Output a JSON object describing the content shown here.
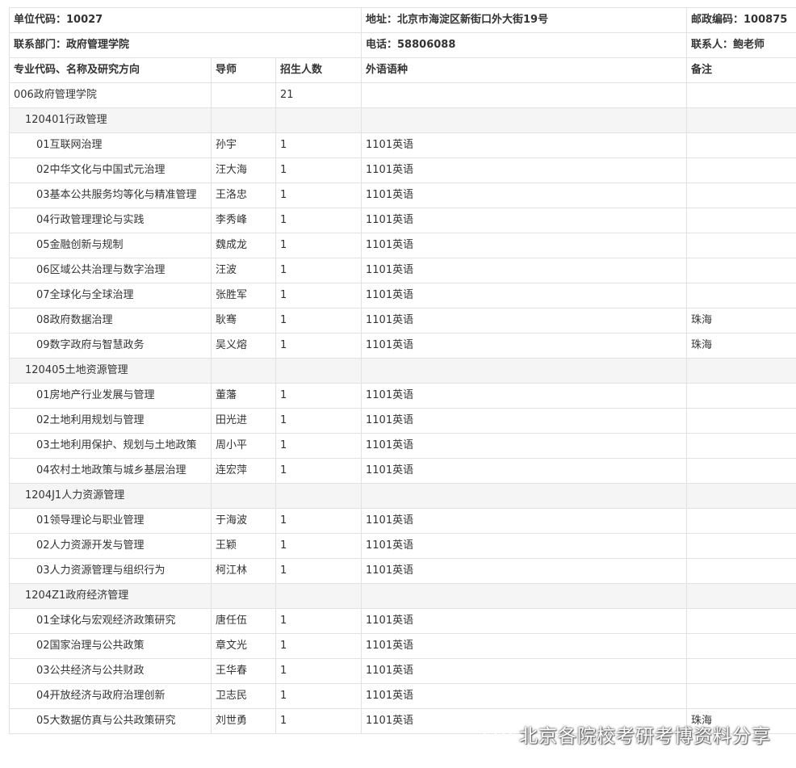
{
  "info": {
    "unit_code": "单位代码：10027",
    "address": "地址：北京市海淀区新街口外大街19号",
    "postal_code": "邮政编码：100875",
    "department": "联系部门：政府管理学院",
    "phone": "电话：58806088",
    "contact": "联系人：鲍老师"
  },
  "headers": {
    "major": "专业代码、名称及研究方向",
    "advisor": "导师",
    "count": "招生人数",
    "language": "外语语种",
    "note": "备注"
  },
  "rows": [
    {
      "type": "dept",
      "name": "006政府管理学院",
      "advisor": "",
      "count": "21",
      "language": "",
      "note": ""
    },
    {
      "type": "major",
      "name": "120401行政管理",
      "advisor": "",
      "count": "",
      "language": "",
      "note": ""
    },
    {
      "type": "dir",
      "name": "01互联网治理",
      "advisor": "孙宇",
      "count": "1",
      "language": "1101英语",
      "note": ""
    },
    {
      "type": "dir",
      "name": "02中华文化与中国式元治理",
      "advisor": "汪大海",
      "count": "1",
      "language": "1101英语",
      "note": ""
    },
    {
      "type": "dir",
      "name": "03基本公共服务均等化与精准管理",
      "advisor": "王洛忠",
      "count": "1",
      "language": "1101英语",
      "note": ""
    },
    {
      "type": "dir",
      "name": "04行政管理理论与实践",
      "advisor": "李秀峰",
      "count": "1",
      "language": "1101英语",
      "note": ""
    },
    {
      "type": "dir",
      "name": "05金融创新与规制",
      "advisor": "魏成龙",
      "count": "1",
      "language": "1101英语",
      "note": ""
    },
    {
      "type": "dir",
      "name": "06区域公共治理与数字治理",
      "advisor": "汪波",
      "count": "1",
      "language": "1101英语",
      "note": ""
    },
    {
      "type": "dir",
      "name": "07全球化与全球治理",
      "advisor": "张胜军",
      "count": "1",
      "language": "1101英语",
      "note": ""
    },
    {
      "type": "dir",
      "name": "08政府数据治理",
      "advisor": "耿骞",
      "count": "1",
      "language": "1101英语",
      "note": "珠海"
    },
    {
      "type": "dir",
      "name": "09数字政府与智慧政务",
      "advisor": "吴义熔",
      "count": "1",
      "language": "1101英语",
      "note": "珠海"
    },
    {
      "type": "major",
      "name": "120405土地资源管理",
      "advisor": "",
      "count": "",
      "language": "",
      "note": ""
    },
    {
      "type": "dir",
      "name": "01房地产行业发展与管理",
      "advisor": "董藩",
      "count": "1",
      "language": "1101英语",
      "note": ""
    },
    {
      "type": "dir",
      "name": "02土地利用规划与管理",
      "advisor": "田光进",
      "count": "1",
      "language": "1101英语",
      "note": ""
    },
    {
      "type": "dir",
      "name": "03土地利用保护、规划与土地政策",
      "advisor": "周小平",
      "count": "1",
      "language": "1101英语",
      "note": ""
    },
    {
      "type": "dir",
      "name": "04农村土地政策与城乡基层治理",
      "advisor": "连宏萍",
      "count": "1",
      "language": "1101英语",
      "note": ""
    },
    {
      "type": "major",
      "name": "1204J1人力资源管理",
      "advisor": "",
      "count": "",
      "language": "",
      "note": ""
    },
    {
      "type": "dir",
      "name": "01领导理论与职业管理",
      "advisor": "于海波",
      "count": "1",
      "language": "1101英语",
      "note": ""
    },
    {
      "type": "dir",
      "name": "02人力资源开发与管理",
      "advisor": "王颖",
      "count": "1",
      "language": "1101英语",
      "note": ""
    },
    {
      "type": "dir",
      "name": "03人力资源管理与组织行为",
      "advisor": "柯江林",
      "count": "1",
      "language": "1101英语",
      "note": ""
    },
    {
      "type": "major",
      "name": "1204Z1政府经济管理",
      "advisor": "",
      "count": "",
      "language": "",
      "note": ""
    },
    {
      "type": "dir",
      "name": "01全球化与宏观经济政策研究",
      "advisor": "唐任伍",
      "count": "1",
      "language": "1101英语",
      "note": ""
    },
    {
      "type": "dir",
      "name": "02国家治理与公共政策",
      "advisor": "章文光",
      "count": "1",
      "language": "1101英语",
      "note": ""
    },
    {
      "type": "dir",
      "name": "03公共经济与公共财政",
      "advisor": "王华春",
      "count": "1",
      "language": "1101英语",
      "note": ""
    },
    {
      "type": "dir",
      "name": "04开放经济与政府治理创新",
      "advisor": "卫志民",
      "count": "1",
      "language": "1101英语",
      "note": ""
    },
    {
      "type": "dir",
      "name": "05大数据仿真与公共政策研究",
      "advisor": "刘世勇",
      "count": "1",
      "language": "1101英语",
      "note": "珠海"
    }
  ],
  "watermark": {
    "text": "北京各院校考研考博资料分享",
    "icon": "wechat-icon"
  }
}
